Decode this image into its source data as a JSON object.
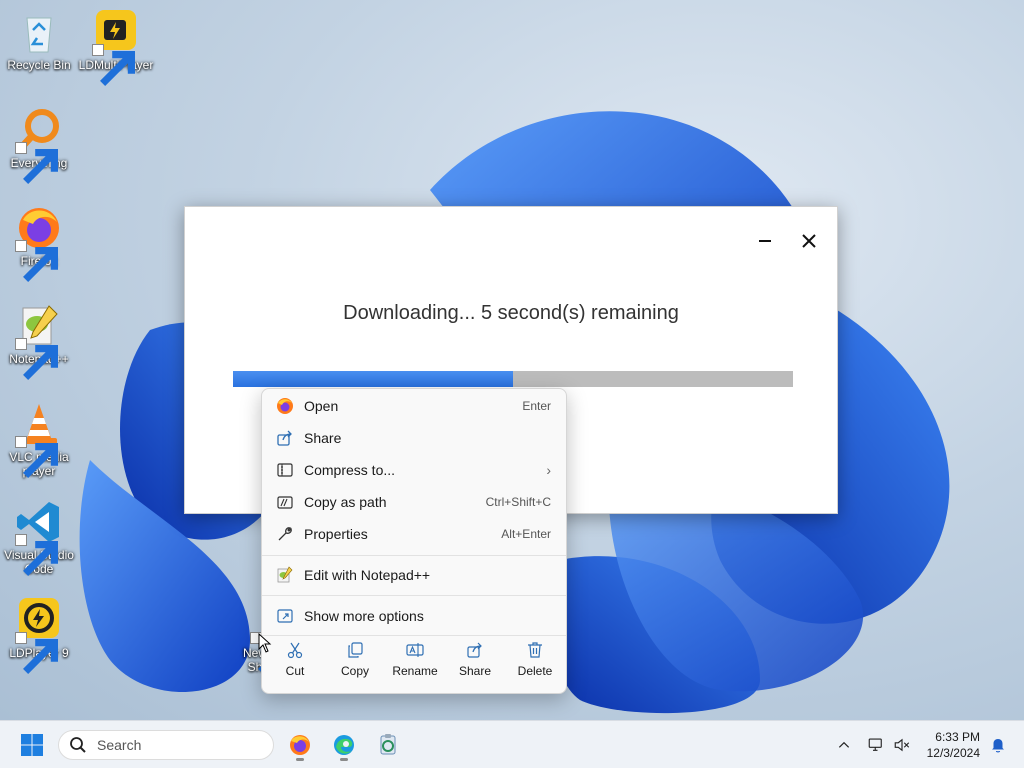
{
  "desktop_icons": [
    {
      "label": "Recycle Bin"
    },
    {
      "label": "LDMultiPlayer"
    },
    {
      "label": "Everything"
    },
    {
      "label": "Firefox"
    },
    {
      "label": "Notepad++"
    },
    {
      "label": "VLC media player"
    },
    {
      "label": "Visual Studio Code"
    },
    {
      "label": "LDPlayer 9"
    },
    {
      "label": "New Sh"
    }
  ],
  "dialog": {
    "status": "Downloading... 5 second(s) remaining",
    "progress_percent": 50
  },
  "context_menu": {
    "items": [
      {
        "label": "Open",
        "shortcut": "Enter",
        "icon": "firefox-icon"
      },
      {
        "label": "Share",
        "shortcut": "",
        "icon": "share-icon"
      },
      {
        "label": "Compress to...",
        "shortcut": "",
        "icon": "zip-folder-icon"
      },
      {
        "label": "Copy as path",
        "shortcut": "Ctrl+Shift+C",
        "icon": "path-icon"
      },
      {
        "label": "Properties",
        "shortcut": "Alt+Enter",
        "icon": "wrench-icon"
      },
      {
        "label": "Edit with Notepad++",
        "shortcut": "",
        "icon": "notepadpp-icon"
      },
      {
        "label": "Show more options",
        "shortcut": "",
        "icon": "more-options-icon"
      }
    ],
    "bottom_actions": [
      {
        "label": "Cut",
        "icon": "scissors-icon"
      },
      {
        "label": "Copy",
        "icon": "copy-icon"
      },
      {
        "label": "Rename",
        "icon": "rename-icon"
      },
      {
        "label": "Share",
        "icon": "share-icon"
      },
      {
        "label": "Delete",
        "icon": "trash-icon"
      }
    ]
  },
  "taskbar": {
    "search_placeholder": "Search",
    "time": "6:33 PM",
    "date": "12/3/2024"
  },
  "colors": {
    "progress_fill": "#2a72e0",
    "progress_track": "#bcbcbc",
    "wallpaper_blue": "#1a5ee8"
  }
}
